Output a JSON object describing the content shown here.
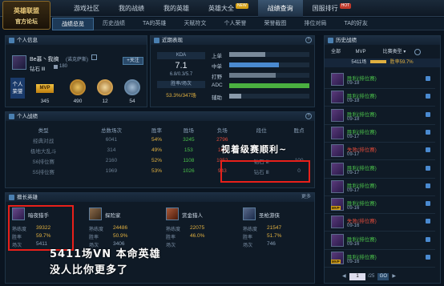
{
  "app": {
    "logo_line1": "英雄联盟",
    "logo_line2": "官方论坛"
  },
  "nav": {
    "items": [
      {
        "label": "游戏社区"
      },
      {
        "label": "我的战绩"
      },
      {
        "label": "我的英雄"
      },
      {
        "label": "英雄大全",
        "badge": "NEW"
      },
      {
        "label": "战绩查询",
        "active": true
      },
      {
        "label": "国服排行",
        "badge": "HOT"
      }
    ]
  },
  "subnav": {
    "items": [
      "战绩总览",
      "历史战绩",
      "TA的英雄",
      "天赋符文",
      "个人荣誉",
      "荣誉截图",
      "排位对局",
      "TA的好友"
    ]
  },
  "profile": {
    "section_title": "个人信息",
    "name": "Be慕丶我搞",
    "server": "(诺克萨斯)",
    "rank": "钻石 Ⅲ",
    "level": "180",
    "add_friend": "+关注",
    "honor_label": "个人\n荣誉",
    "medals": [
      {
        "label": "MVP",
        "value": "345"
      },
      {
        "value": "490"
      },
      {
        "value": "12"
      },
      {
        "value": "54"
      }
    ]
  },
  "recent": {
    "section_title": "近期表现",
    "kda_label": "KDA",
    "kda_value": "7.1",
    "kda_detail": "6.8/0.3/5.7",
    "winrate_label": "胜率/场次",
    "winrate_value": "53.3%/347场",
    "roles": [
      {
        "label": "上单",
        "pct": 0.45
      },
      {
        "label": "中单",
        "pct": 0.62
      },
      {
        "label": "打野",
        "pct": 0.58
      },
      {
        "label": "ADC",
        "pct": 1.0
      },
      {
        "label": "辅助",
        "pct": 0.15
      }
    ]
  },
  "battles": {
    "section_title": "个人战绩",
    "headers": [
      "类型",
      "总数场次",
      "胜率",
      "胜场",
      "负场",
      "段位",
      "胜点"
    ],
    "rows": [
      [
        "经典对战",
        "6041",
        "54%",
        "3245",
        "2796",
        "",
        ""
      ],
      [
        "极地大乱斗",
        "314",
        "49%",
        "153",
        "161",
        "",
        ""
      ],
      [
        "S6排位赛",
        "2160",
        "52%",
        "1108",
        "1052",
        "钻石 Ⅲ",
        "100"
      ],
      [
        "S5排位赛",
        "1969",
        "53%",
        "1026",
        "943",
        "钻石 Ⅲ",
        "0"
      ]
    ]
  },
  "heroes": {
    "section_title": "擅长英雄",
    "more": "更多",
    "list": [
      {
        "name": "暗夜猎手",
        "games_label": "熟练度",
        "games": "39322",
        "rate_label": "胜率",
        "rate": "59.7%",
        "count_label": "场次",
        "count": "5411"
      },
      {
        "name": "探险家",
        "games_label": "熟练度",
        "games": "24486",
        "rate_label": "胜率",
        "rate": "50.9%",
        "count_label": "场次",
        "count": "3406"
      },
      {
        "name": "赏金猎人",
        "games_label": "熟练度",
        "games": "22075",
        "rate_label": "胜率",
        "rate": "46.0%",
        "count_label": "场次",
        "count": ""
      },
      {
        "name": "圣枪游侠",
        "games_label": "熟练度",
        "games": "21547",
        "rate_label": "胜率",
        "rate": "51.7%",
        "count_label": "场次",
        "count": "746"
      }
    ]
  },
  "history": {
    "section_title": "历史战绩",
    "tabs": [
      "全部",
      "MVP",
      "比赛类型 ▾"
    ],
    "summary_count": "5411场",
    "summary_rate": "胜率59.7%",
    "items": [
      {
        "result": "胜利(排位赛)",
        "date": "09-18",
        "win": true
      },
      {
        "result": "胜利(排位赛)",
        "date": "09-18",
        "win": true
      },
      {
        "result": "胜利(排位赛)",
        "date": "09-18",
        "win": true
      },
      {
        "result": "胜利(排位赛)",
        "date": "09-17",
        "win": true
      },
      {
        "result": "失败(排位赛)",
        "date": "09-17",
        "win": false
      },
      {
        "result": "胜利(排位赛)",
        "date": "09-17",
        "win": true
      },
      {
        "result": "胜利(排位赛)",
        "date": "09-17",
        "win": true
      },
      {
        "result": "胜利(排位赛)",
        "date": "09-16",
        "win": true,
        "mvp": true
      },
      {
        "result": "失败(排位赛)",
        "date": "09-16",
        "win": false
      },
      {
        "result": "胜利(排位赛)",
        "date": "09-16",
        "win": true
      },
      {
        "result": "胜利(排位赛)",
        "date": "09-16",
        "win": true,
        "mvp": true
      }
    ],
    "pager_page": "1",
    "pager_total": "/25",
    "pager_go": "GO"
  },
  "overlay": {
    "note1": "视着级赛顺利~",
    "note2": "5411场VN  本命英雄",
    "note3": "没人比你更多了"
  }
}
